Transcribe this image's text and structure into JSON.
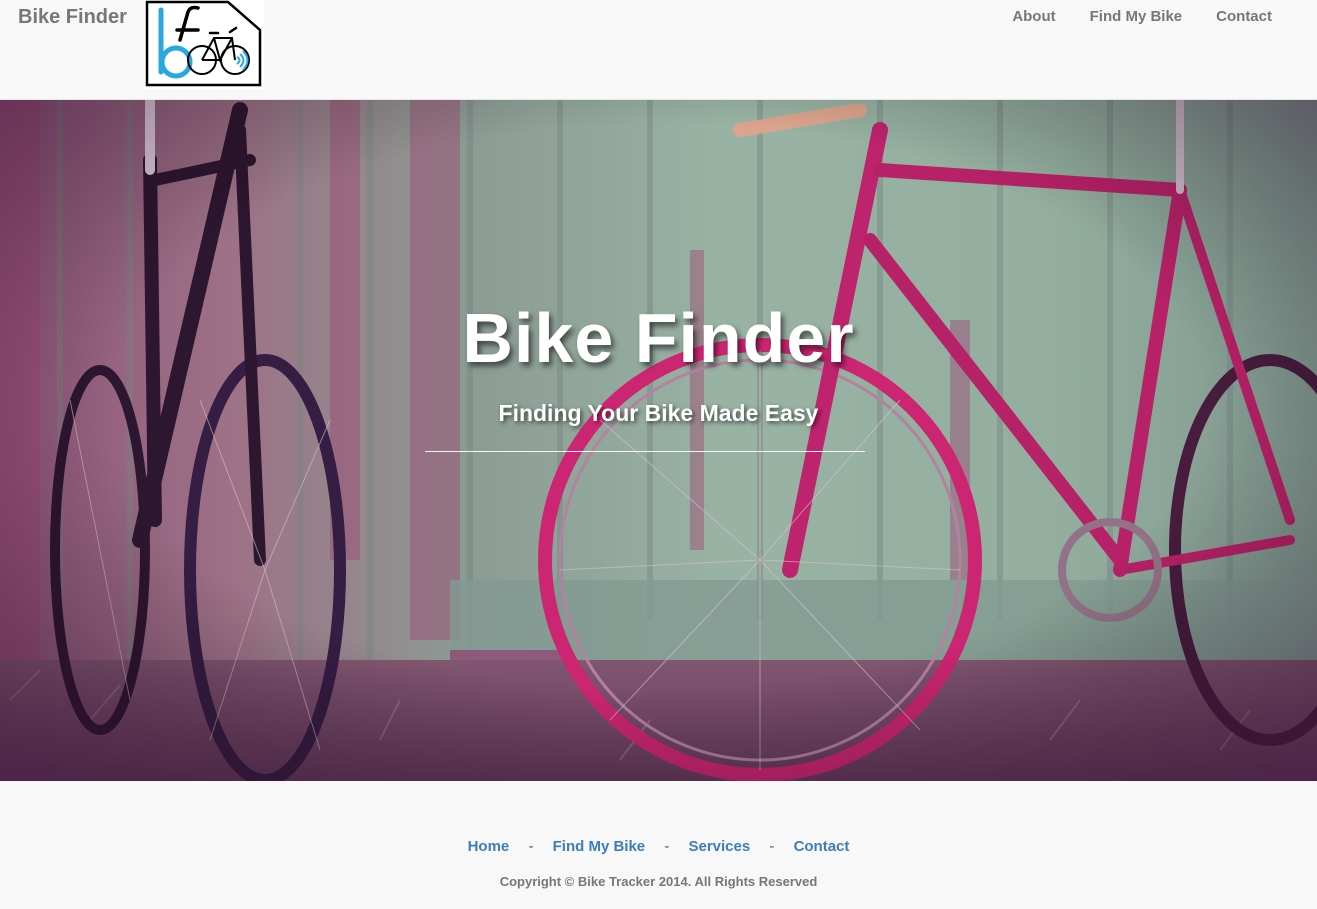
{
  "navbar": {
    "brand": "Bike Finder",
    "logo_icon": "bike-finder-logo-icon",
    "links": [
      "About",
      "Find My Bike",
      "Contact"
    ]
  },
  "hero": {
    "title": "Bike Finder",
    "subtitle": "Finding Your Bike Made Easy",
    "background_icon": "bicycles-photo"
  },
  "footer": {
    "links": [
      "Home",
      "Find My Bike",
      "Services",
      "Contact"
    ],
    "separator": "-",
    "copyright": "Copyright © Bike Tracker 2014. All Rights Reserved"
  },
  "colors": {
    "nav_text": "#777777",
    "footer_link": "#3d7dbd",
    "logo_accent": "#29a8e0"
  }
}
